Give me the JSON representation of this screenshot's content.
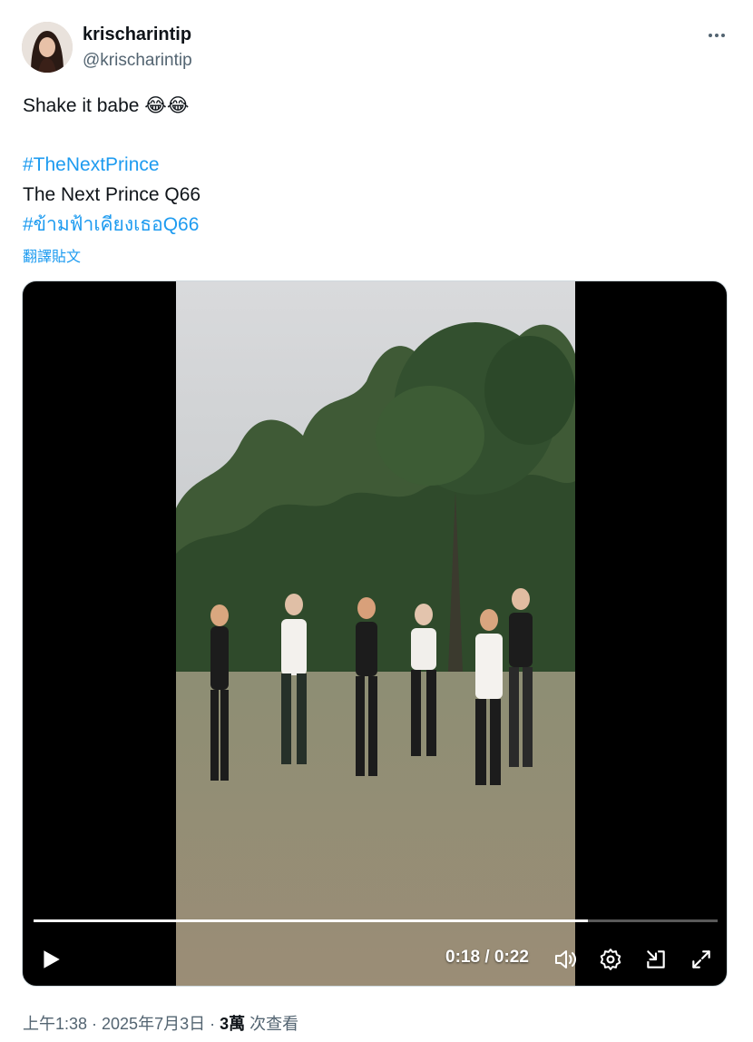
{
  "author": {
    "display_name": "krischarintip",
    "handle": "@krischarintip"
  },
  "post": {
    "text_line1": "Shake it babe",
    "text_emojis": "😂😂",
    "hashtag1": "#TheNextPrince",
    "line2": "The Next Prince Q66",
    "hashtag2": "#ข้ามฟ้าเคียงเธอQ66",
    "translate_label": "翻譯貼文"
  },
  "video": {
    "current_time": "0:18",
    "separator": "/",
    "duration": "0:22",
    "progress_fraction": 0.81
  },
  "icons": [
    "more-icon",
    "play-icon",
    "volume-icon",
    "settings-icon",
    "pop-out-icon",
    "fullscreen-icon"
  ],
  "meta": {
    "timestamp": "上午1:38 · 2025年7月3日 · ",
    "views_count": "3萬",
    "views_label": " 次查看"
  },
  "colors": {
    "accent": "#1d9bf0",
    "secondary_text": "#536471",
    "primary_text": "#0f1419"
  }
}
